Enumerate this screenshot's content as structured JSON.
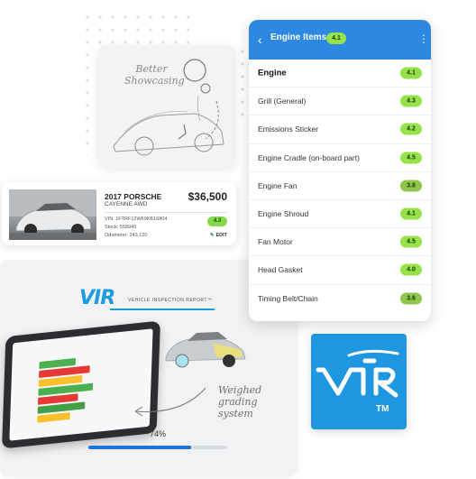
{
  "colors": {
    "header_blue": "#2d88e2",
    "score_green": "#97e14a",
    "score_olive": "#8fc74a",
    "vir_blue": "#1e97e0",
    "progress_blue": "#1b75e0"
  },
  "sketch_card": {
    "caption_line1": "Better",
    "caption_line2": "Showcasing"
  },
  "listing": {
    "title": "2017 PORSCHE",
    "subtitle": "CAYENNE AWD",
    "price": "$36,500",
    "vin": "VIN: 1FTRF12W69KB16804",
    "stock": "Stock: 558940",
    "odometer": "Odometer: 243,120",
    "score": "4.3",
    "edit_label": "EDIT",
    "edit_icon": "pencil-icon"
  },
  "inspection": {
    "logo_text": "VIR",
    "logo_caption": "VEHICLE INSPECTION REPORT™",
    "caption_line1": "Weighed grading",
    "caption_line2": "system",
    "progress_label": "74%",
    "progress_value": 0.74
  },
  "engine_panel": {
    "title": "Engine Items",
    "title_score": "4.1",
    "back_icon": "chevron-left-icon",
    "menu_icon": "kebab-menu-icon",
    "items": [
      {
        "label": "Engine",
        "score": "4.1",
        "bold": true,
        "color": "#97e14a"
      },
      {
        "label": "Grill (General)",
        "score": "4.3",
        "bold": false,
        "color": "#97e14a"
      },
      {
        "label": "Emissions Sticker",
        "score": "4.2",
        "bold": false,
        "color": "#97e14a"
      },
      {
        "label": "Engine Cradle (on-board part)",
        "score": "4.5",
        "bold": false,
        "color": "#97e14a"
      },
      {
        "label": "Engine Fan",
        "score": "3.8",
        "bold": false,
        "color": "#8fc74a"
      },
      {
        "label": "Engine Shroud",
        "score": "4.1",
        "bold": false,
        "color": "#97e14a"
      },
      {
        "label": "Fan Motor",
        "score": "4.5",
        "bold": false,
        "color": "#97e14a"
      },
      {
        "label": "Head Gasket",
        "score": "4.0",
        "bold": false,
        "color": "#97e14a"
      },
      {
        "label": "Timing Belt/Chain",
        "score": "3.6",
        "bold": false,
        "color": "#8fc74a"
      }
    ]
  },
  "brand_tile": {
    "logo_text": "VIR",
    "trademark": "TM"
  }
}
